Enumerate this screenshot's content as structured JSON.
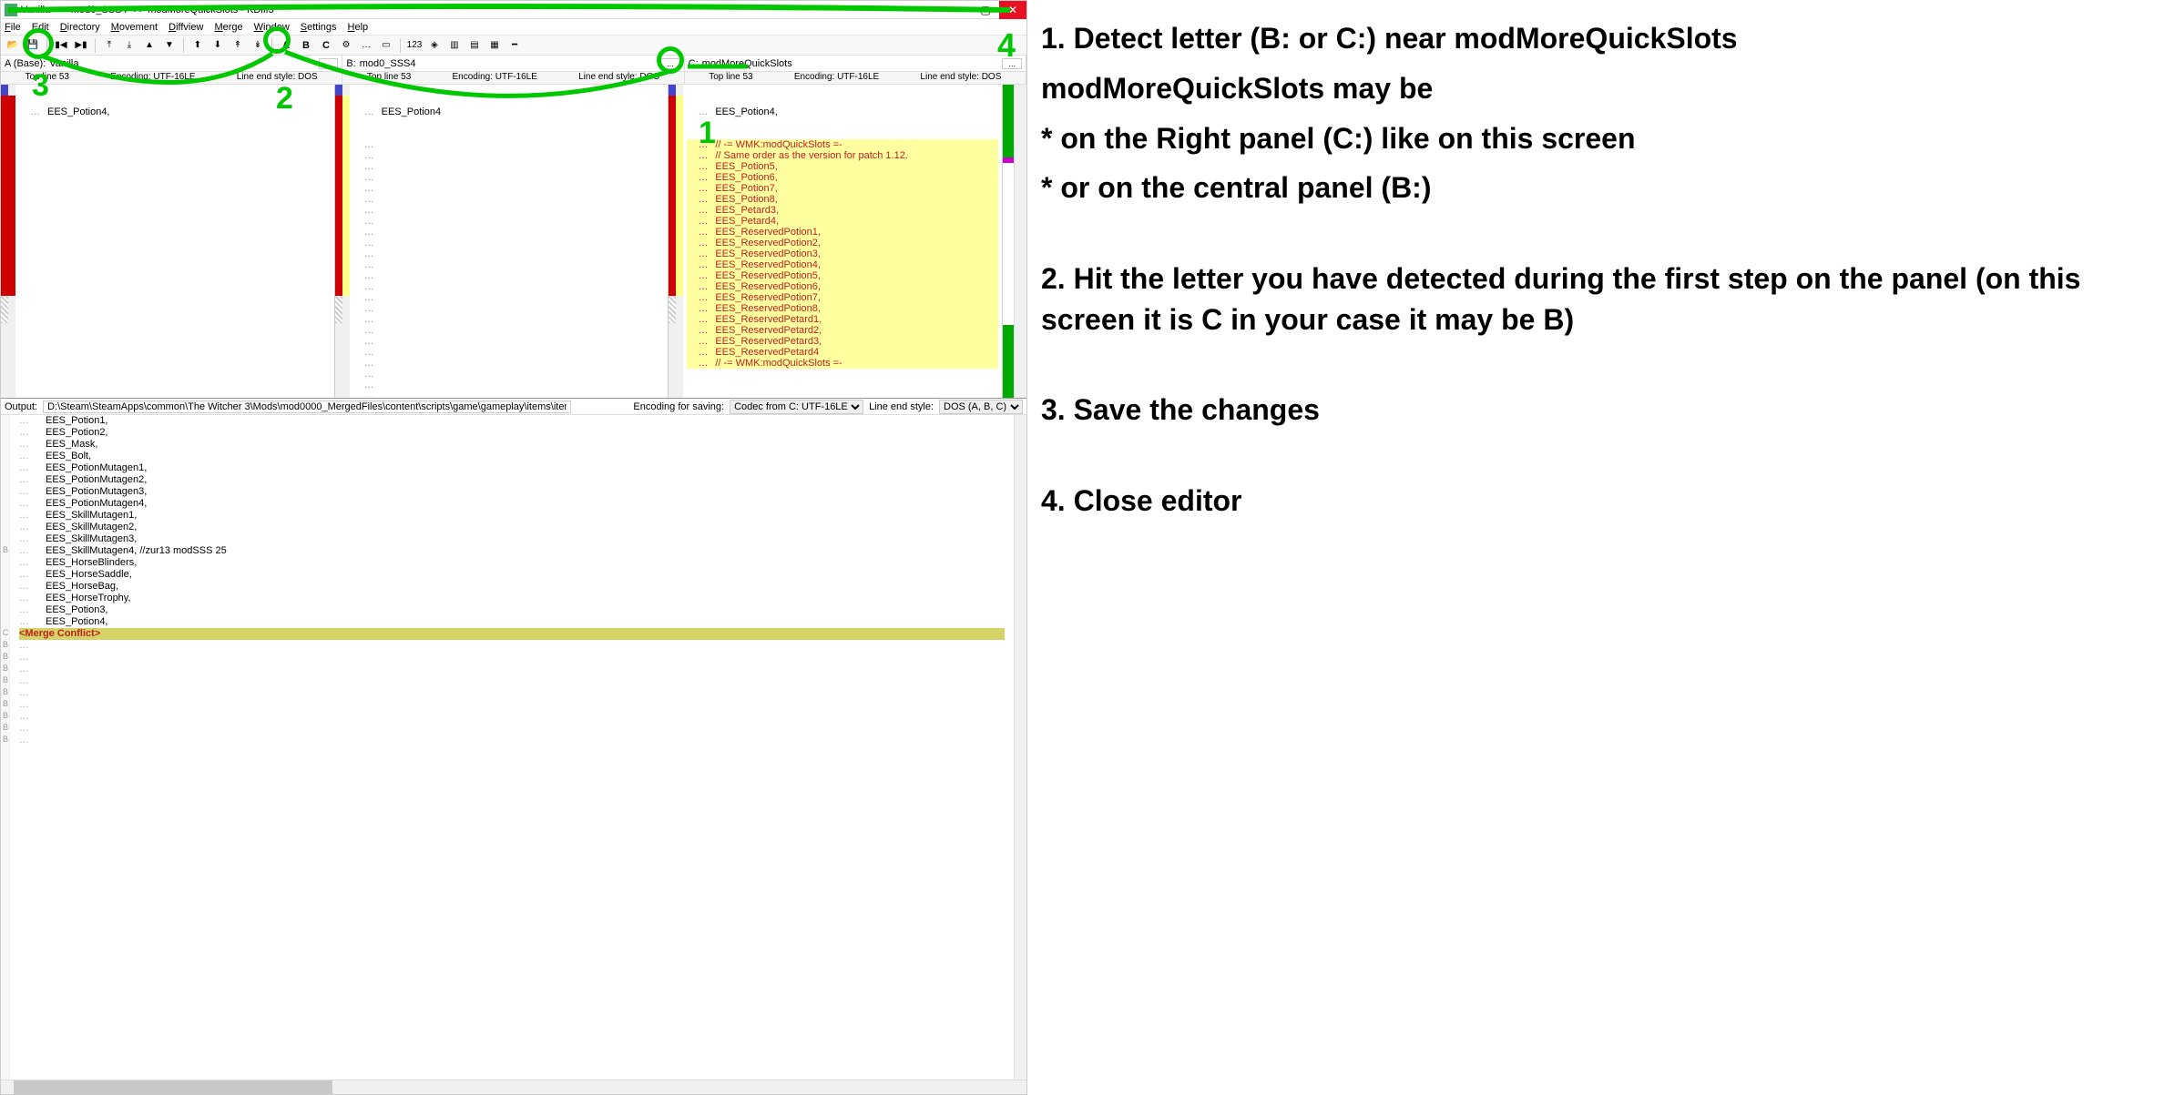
{
  "title": "Vanilla <-> mod0_SSS4 <-> modMoreQuickSlots - KDiff3",
  "menu": [
    "File",
    "Edit",
    "Directory",
    "Movement",
    "Diffview",
    "Merge",
    "Window",
    "Settings",
    "Help"
  ],
  "toolbar_letters": [
    "A",
    "B",
    "C"
  ],
  "toolbar_num": "123",
  "files": {
    "a_label": "A (Base):",
    "a_value": "Vanilla",
    "b_label": "B:",
    "b_value": "mod0_SSS4",
    "c_label": "C:",
    "c_value": "modMoreQuickSlots"
  },
  "info": {
    "topline": "Top line 53",
    "encoding": "Encoding: UTF-16LE",
    "lineend": "Line end style: DOS"
  },
  "panel_a_line": "EES_Potion4,",
  "panel_b_line": "EES_Potion4",
  "panel_c_top": "EES_Potion4,",
  "panel_c_lines": [
    "// -= WMK:modQuickSlots =-",
    "// Same order as the version for patch 1.12.",
    "EES_Potion5,",
    "EES_Potion6,",
    "EES_Potion7,",
    "EES_Potion8,",
    "EES_Petard3,",
    "EES_Petard4,",
    "EES_ReservedPotion1,",
    "EES_ReservedPotion2,",
    "EES_ReservedPotion3,",
    "EES_ReservedPotion4,",
    "EES_ReservedPotion5,",
    "EES_ReservedPotion6,",
    "EES_ReservedPotion7,",
    "EES_ReservedPotion8,",
    "EES_ReservedPetard1,",
    "EES_ReservedPetard2,",
    "EES_ReservedPetard3,",
    "EES_ReservedPetard4",
    "// -= WMK:modQuickSlots =-"
  ],
  "output": {
    "label": "Output:",
    "path": "D:\\Steam\\SteamApps\\common\\The Witcher 3\\Mods\\mod0000_MergedFiles\\content\\scripts\\game\\gameplay\\items\\itemsTypes.ws",
    "enc_label": "Encoding for saving:",
    "enc_value": "Codec from C: UTF-16LE",
    "lineend_label": "Line end style:",
    "lineend_value": "DOS (A, B, C)"
  },
  "output_lines": [
    "EES_Potion1,",
    "EES_Potion2,",
    "EES_Mask,",
    "EES_Bolt,",
    "EES_PotionMutagen1,",
    "EES_PotionMutagen2,",
    "EES_PotionMutagen3,",
    "EES_PotionMutagen4,",
    "EES_SkillMutagen1,",
    "EES_SkillMutagen2,",
    "EES_SkillMutagen3,",
    "EES_SkillMutagen4, //zur13 modSSS 25",
    "EES_HorseBlinders,",
    "EES_HorseSaddle,",
    "EES_HorseBag,",
    "EES_HorseTrophy,",
    "EES_Potion3,",
    "EES_Potion4,"
  ],
  "conflict_text": "<Merge Conflict>",
  "output_gutter": [
    "",
    "",
    "",
    "",
    "",
    "",
    "",
    "",
    "",
    "",
    "",
    "B",
    "",
    "",
    "",
    "",
    "",
    "",
    "C",
    "B",
    "B",
    "B",
    "B",
    "B",
    "B",
    "B",
    "B",
    "B"
  ],
  "instructions": {
    "s1a": "1. Detect letter (B: or C:) near modMoreQuickSlots",
    "s1b": "modMoreQuickSlots may be",
    "s1c": "* on the Right panel (C:) like on this screen",
    "s1d": "* or on the central panel (B:)",
    "s2": "2. Hit the letter you have detected during the first step on the panel (on this screen it is C in your case it may be B)",
    "s3": "3. Save the changes",
    "s4": "4. Close editor"
  }
}
